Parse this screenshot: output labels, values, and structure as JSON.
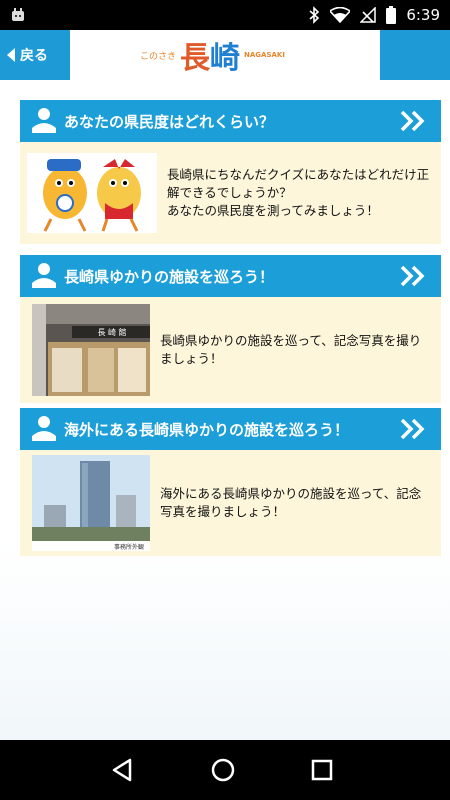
{
  "status_bar": {
    "time": "6:39"
  },
  "app_bar": {
    "back_label": "戻る",
    "logo_small": "このさき",
    "logo_main": "長崎",
    "logo_en": "NAGASAKI"
  },
  "sections": [
    {
      "title": "あなたの県民度はどれくらい？",
      "description": "長崎県にちなんだクイズにあなたはどれだけ正解できるでしょうか？\nあなたの県民度を測ってみましょう！",
      "thumb": "mascot-characters"
    },
    {
      "title": "長崎県ゆかりの施設を巡ろう！",
      "description": "長崎県ゆかりの施設を巡って、記念写真を撮りましょう！",
      "thumb": "shop-storefront",
      "thumb_text": "長 崎 館"
    },
    {
      "title": "海外にある長崎県ゆかりの施設を巡ろう！",
      "description": "海外にある長崎県ゆかりの施設を巡って、記念写真を撮りましょう！",
      "thumb": "office-tower",
      "thumb_caption": "事務所外観"
    }
  ],
  "colors": {
    "accent": "#1c9ed9",
    "panel": "#fdf6db",
    "logo_red": "#e05a2a",
    "logo_blue": "#1f7fd0"
  }
}
